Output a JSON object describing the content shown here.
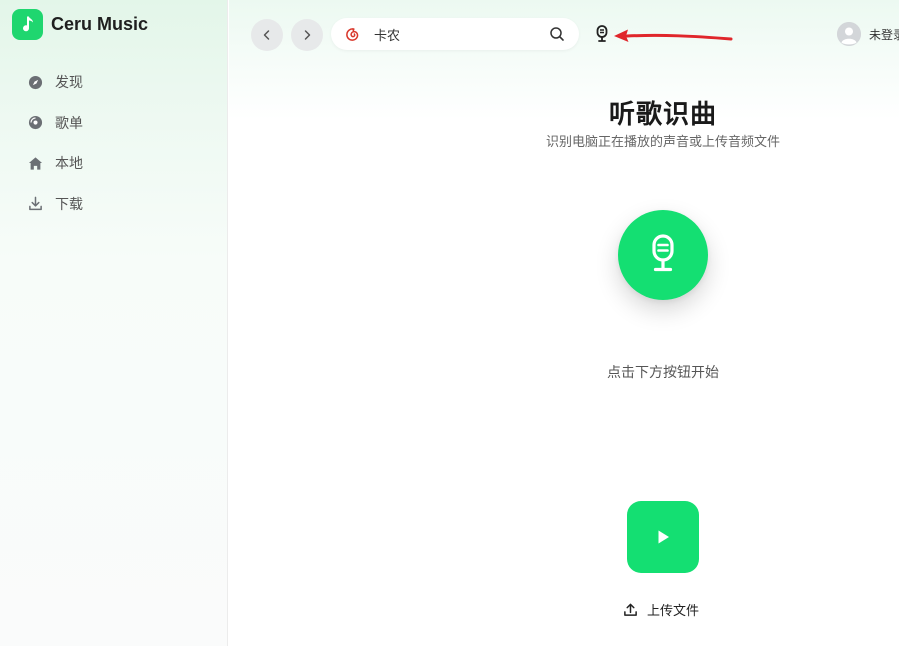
{
  "app": {
    "name": "Ceru Music"
  },
  "sidebar": {
    "items": [
      {
        "label": "发现",
        "icon": "compass-icon"
      },
      {
        "label": "歌单",
        "icon": "disc-icon"
      },
      {
        "label": "本地",
        "icon": "home-icon"
      },
      {
        "label": "下载",
        "icon": "download-icon"
      }
    ]
  },
  "topbar": {
    "search_value": "卡农",
    "search_source_icon": "netease-music-icon",
    "user_label": "未登录"
  },
  "main": {
    "title": "听歌识曲",
    "subtitle": "识别电脑正在播放的声音或上传音频文件",
    "hint": "点击下方按钮开始",
    "upload_label": "上传文件"
  },
  "colors": {
    "accent": "#14df72",
    "annotation_arrow": "#e0262b",
    "source_icon": "#d9372b"
  }
}
